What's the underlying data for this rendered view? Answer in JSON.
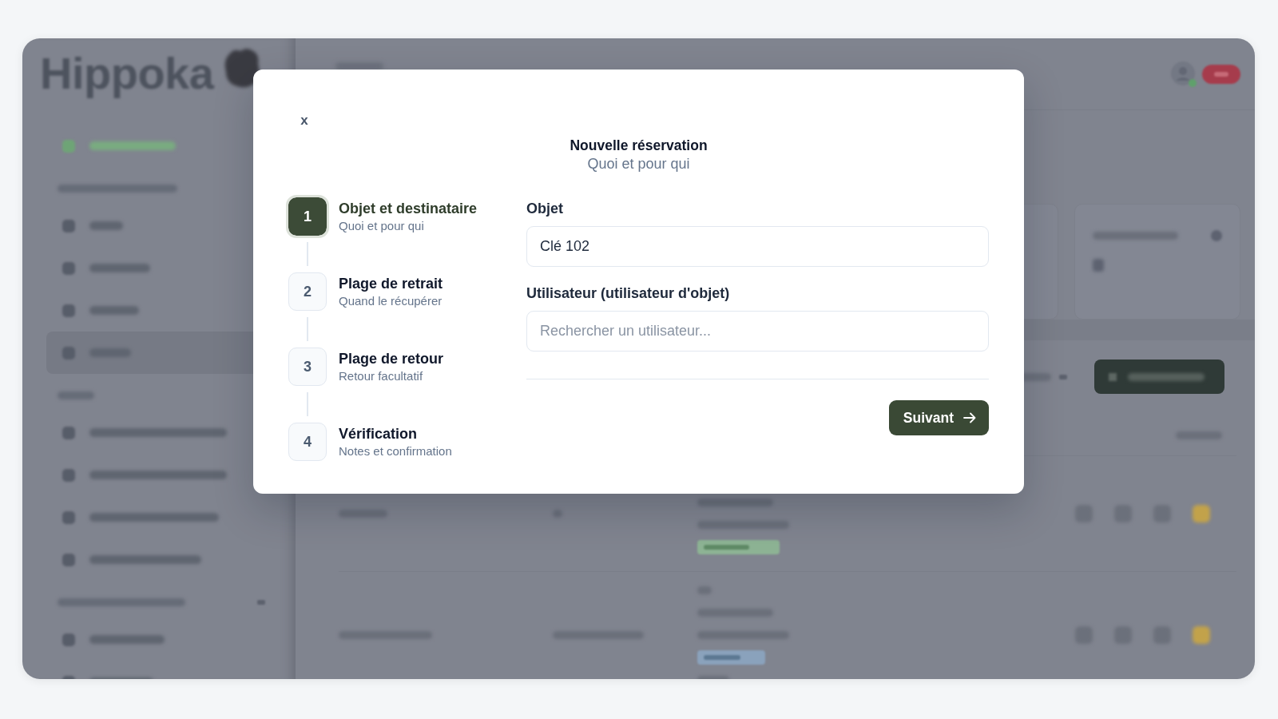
{
  "backdrop": {
    "logo": "Hippoka",
    "sidebar": [
      {
        "kind": "accent",
        "selected": false
      },
      {
        "kind": "section"
      },
      {
        "kind": "link",
        "selected": false
      },
      {
        "kind": "link",
        "selected": false
      },
      {
        "kind": "link",
        "selected": false
      },
      {
        "kind": "link",
        "selected": true
      },
      {
        "kind": "section"
      },
      {
        "kind": "link",
        "selected": false
      },
      {
        "kind": "link",
        "selected": false
      },
      {
        "kind": "link",
        "selected": false
      },
      {
        "kind": "link",
        "selected": false
      },
      {
        "kind": "section"
      },
      {
        "kind": "link",
        "selected": false
      },
      {
        "kind": "link",
        "selected": false
      }
    ]
  },
  "dialog": {
    "close": "x",
    "title": "Nouvelle réservation",
    "subtitle": "Quoi et pour qui"
  },
  "steps": [
    {
      "number": "1",
      "title": "Objet et destinataire",
      "subtitle": "Quoi et pour qui",
      "selected": true
    },
    {
      "number": "2",
      "title": "Plage de retrait",
      "subtitle": "Quand le récupérer",
      "selected": false
    },
    {
      "number": "3",
      "title": "Plage de retour",
      "subtitle": "Retour facultatif",
      "selected": false
    },
    {
      "number": "4",
      "title": "Vérification",
      "subtitle": "Notes et confirmation",
      "selected": false
    }
  ],
  "form": {
    "fields": [
      {
        "label": "Objet",
        "value": "Clé 102"
      },
      {
        "label": "Utilisateur (utilisateur d'objet)",
        "placeholder": "Rechercher un utilisateur..."
      }
    ],
    "next_button": "Suivant"
  }
}
